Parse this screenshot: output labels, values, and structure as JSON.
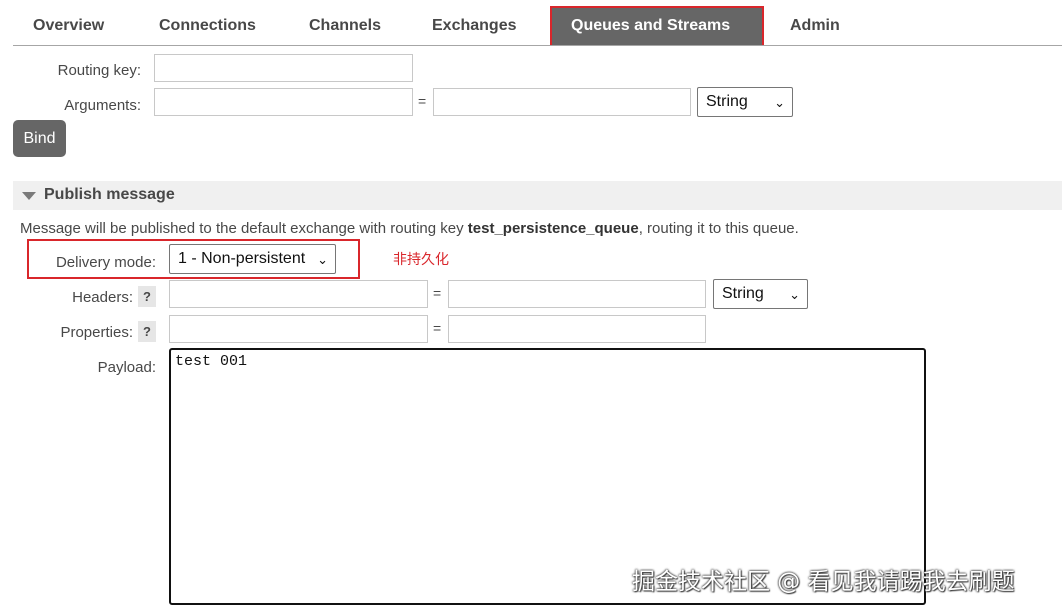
{
  "nav": {
    "tabs": [
      {
        "label": "Overview"
      },
      {
        "label": "Connections"
      },
      {
        "label": "Channels"
      },
      {
        "label": "Exchanges"
      },
      {
        "label": "Queues and Streams",
        "active": true
      },
      {
        "label": "Admin"
      }
    ]
  },
  "bind_form": {
    "routing_key_label": "Routing key:",
    "routing_key_value": "",
    "arguments_label": "Arguments:",
    "arguments_key": "",
    "equals": "=",
    "arguments_value": "",
    "arguments_type": "String",
    "bind_button": "Bind"
  },
  "publish": {
    "section_title": "Publish message",
    "info_prefix": "Message will be published to the default exchange with routing key ",
    "routing_key": "test_persistence_queue",
    "info_suffix": ", routing it to this queue.",
    "delivery_mode_label": "Delivery mode:",
    "delivery_mode_value": "1 - Non-persistent",
    "annotation": "非持久化",
    "headers_label": "Headers:",
    "headers_help": "?",
    "headers_key": "",
    "headers_value": "",
    "headers_type": "String",
    "properties_label": "Properties:",
    "properties_help": "?",
    "properties_key": "",
    "properties_value": "",
    "payload_label": "Payload:",
    "payload_value": "test 001",
    "equals": "="
  },
  "watermark": "掘金技术社区 @ 看见我请踢我去刷题",
  "colors": {
    "active_tab_bg": "#666666",
    "highlight_red": "#d9262b",
    "button_bg": "#666666",
    "section_bg": "#f0f0f0"
  }
}
